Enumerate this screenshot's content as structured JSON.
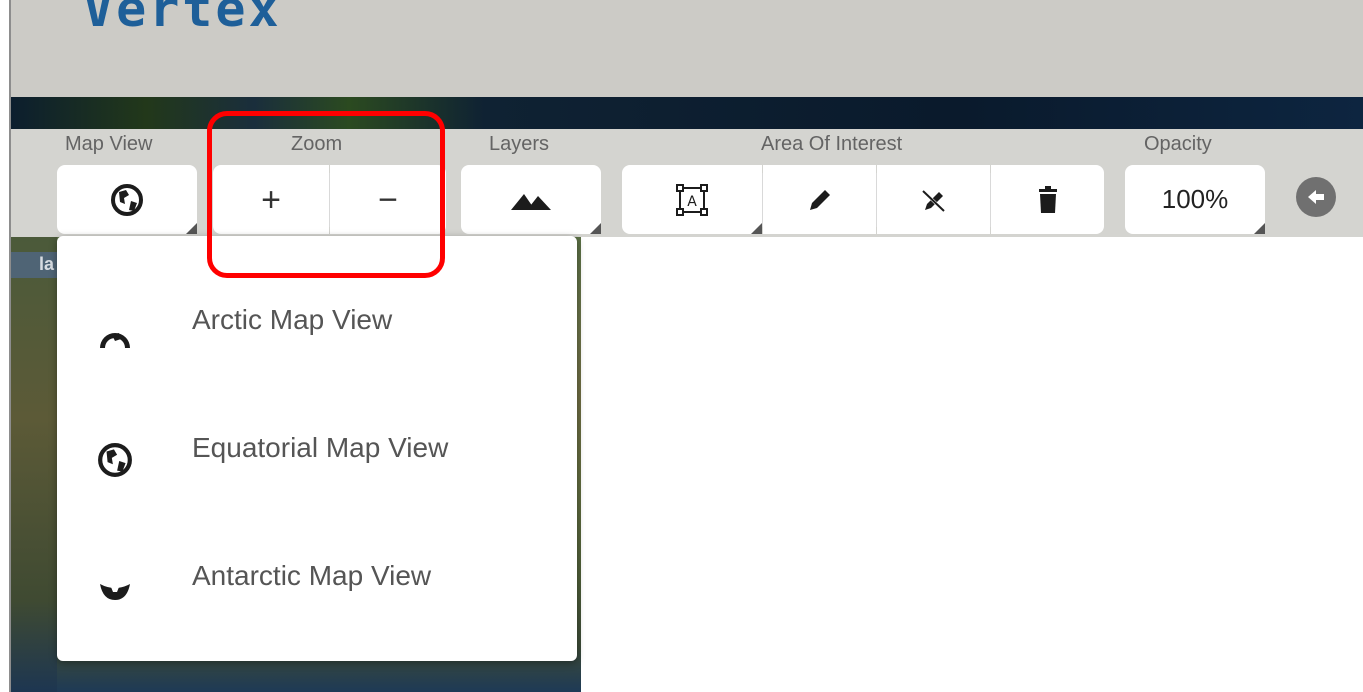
{
  "header": {
    "logo_text": "Vertex"
  },
  "map": {
    "label_fragment": "la"
  },
  "toolbar": {
    "map_view": {
      "label": "Map View",
      "icon": "globe-icon"
    },
    "zoom": {
      "label": "Zoom",
      "zoom_in": "+",
      "zoom_out": "−"
    },
    "layers": {
      "label": "Layers",
      "icon": "mountain-layers-icon"
    },
    "area_of_interest": {
      "label": "Area Of Interest",
      "tools": [
        "draw-box-icon",
        "pencil-icon",
        "pencil-off-icon",
        "trash-icon"
      ]
    },
    "opacity": {
      "label": "Opacity",
      "value": "100%"
    },
    "back": {
      "icon": "arrow-left-circle-icon"
    }
  },
  "map_view_menu": {
    "items": [
      {
        "label": "Arctic Map View",
        "icon": "arctic-globe-icon"
      },
      {
        "label": "Equatorial Map View",
        "icon": "equatorial-globe-icon"
      },
      {
        "label": "Antarctic Map View",
        "icon": "antarctic-globe-icon"
      }
    ]
  },
  "colors": {
    "brand": "#1e5f99",
    "highlight": "#ff0000",
    "header_bg": "#cccbc6",
    "toolbar_bg": "#d4d4d0"
  }
}
